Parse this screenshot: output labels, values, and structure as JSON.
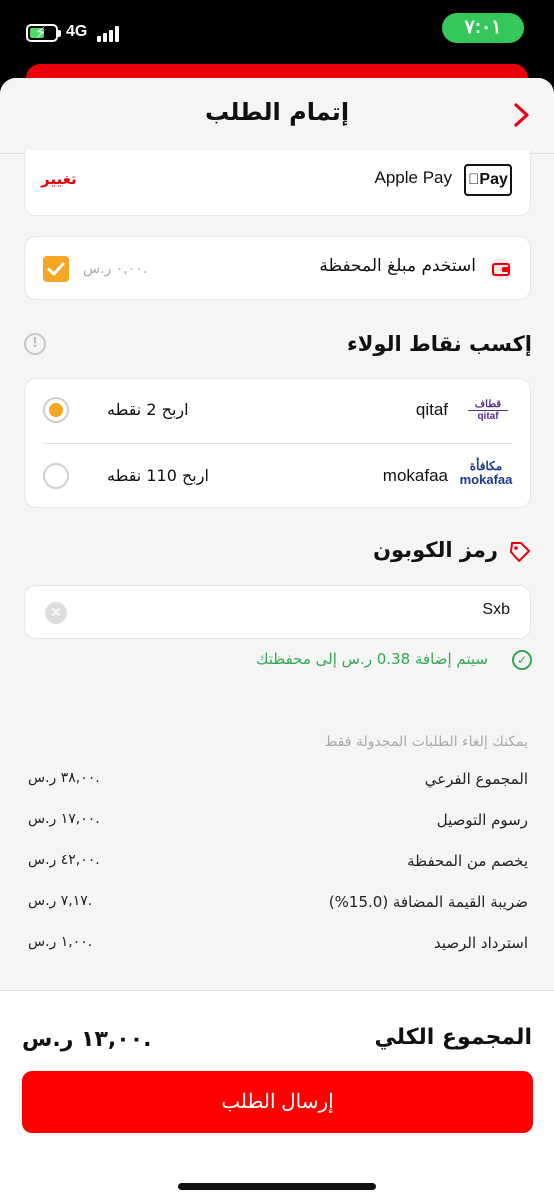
{
  "status_bar": {
    "time": "٧:٠١",
    "network": "4G"
  },
  "header": {
    "title": "إتمام الطلب"
  },
  "payment": {
    "logo_text": "Pay",
    "name": "Apple Pay",
    "change_label": "تغيير"
  },
  "wallet": {
    "label": "استخدم مبلغ المحفظة",
    "amount": "٠,٠٠ ر.س.",
    "checked": true
  },
  "loyalty": {
    "title": "إكسب نقاط الولاء",
    "options": [
      {
        "logo_top": "قطاف",
        "logo_bottom": "qitaf",
        "name": "qitaf",
        "earn": "اربح 2 نقطه",
        "selected": true
      },
      {
        "logo_top": "مكافأة",
        "logo_bottom": "mokafaa",
        "name": "mokafaa",
        "earn": "اربح 110 نقطه",
        "selected": false
      }
    ]
  },
  "coupon": {
    "title": "رمز الكوبون",
    "value": "Sxb",
    "success_message": "سيتم إضافة 0.38 ر.س إلى محفظتك"
  },
  "summary": {
    "note": "يمكنك إلغاء الطلبات المجدولة فقط",
    "rows": [
      {
        "label": "المجموع الفرعي",
        "value": "٣٨,٠٠ ر.س."
      },
      {
        "label": "رسوم التوصيل",
        "value": "١٧,٠٠ ر.س."
      },
      {
        "label": "يخصم من المحفظة",
        "value": "٤٢,٠٠ ر.س."
      },
      {
        "label": "ضريبة القيمة المضافة (15.0%)",
        "value": "٧,١٧ ر.س."
      },
      {
        "label": "استرداد الرصيد",
        "value": "١,٠٠ ر.س."
      }
    ]
  },
  "footer": {
    "total_label": "المجموع الكلي",
    "total_value": "١٣,٠٠ ر.س.",
    "submit_label": "إرسال الطلب"
  },
  "colors": {
    "accent": "#ff0000",
    "checkbox": "#f5a623",
    "success": "#34a853"
  }
}
